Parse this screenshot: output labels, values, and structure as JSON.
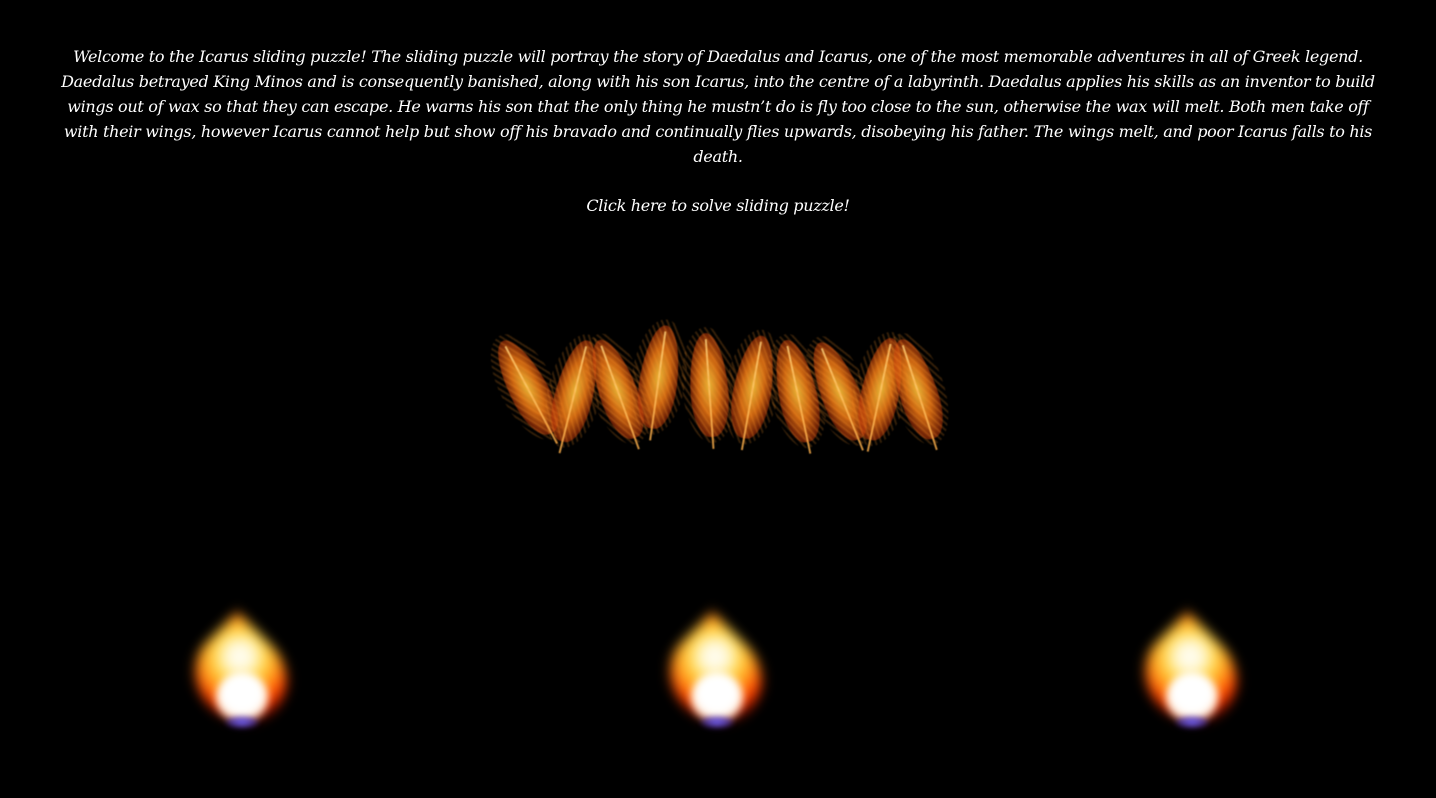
{
  "intro": {
    "text": "Welcome to the Icarus sliding puzzle! The sliding puzzle will portray the story of Daedalus and Icarus, one of the most memorable adventures in all of Greek legend. Daedalus betrayed King Minos and is consequently banished, along with his son Icarus, into the centre of a labyrinth. Daedalus applies his skills as an inventor to build wings out of wax so that they can escape. He warns his son that the only thing he mustn’t do is fly too close to the sun, otherwise the wax will melt. Both men take off with their wings, however Icarus cannot help but show off his bravado and continually flies upwards, disobeying his father. The wings melt, and poor Icarus falls to his death."
  },
  "link": {
    "label": "Click here to solve sliding puzzle!"
  },
  "decor": {
    "feathers_icon": "feathers-icon",
    "flame_icon": "flame-icon",
    "colors": {
      "background": "#000000",
      "text": "#ffffff",
      "feather": "#f07a14",
      "flame": "#ff5a00"
    }
  }
}
